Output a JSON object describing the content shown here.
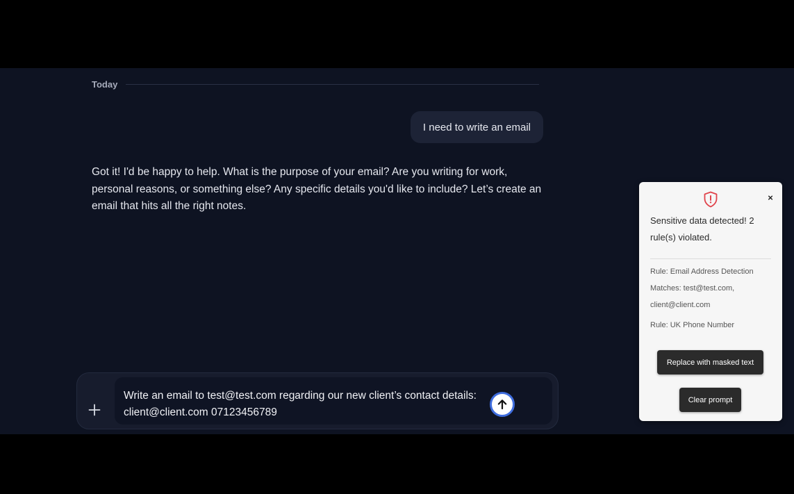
{
  "chat": {
    "date_divider": "Today",
    "user_message": "I need to write an email",
    "assistant_message": "Got it! I'd be happy to help. What is the purpose of your email? Are you writing for work, personal reasons, or something else? Any specific details you'd like to include? Let’s create an email that hits all the right notes."
  },
  "composer": {
    "attach_icon": "plus-icon",
    "prompt_text": "Write an email to test@test.com regarding our new client’s contact details: client@client.com 07123456789",
    "send_icon": "arrow-up-icon"
  },
  "alert": {
    "icon": "shield-alert-icon",
    "close_label": "×",
    "headline": "Sensitive data detected! 2 rule(s) violated.",
    "rules": [
      {
        "name": "Rule: Email Address Detection",
        "matches": "Matches: test@test.com, client@client.com"
      },
      {
        "name": "Rule: UK Phone Number"
      }
    ],
    "mask_button_label": "Replace with masked text",
    "clear_button_label": "Clear prompt",
    "accent_color": "#e0434b"
  }
}
